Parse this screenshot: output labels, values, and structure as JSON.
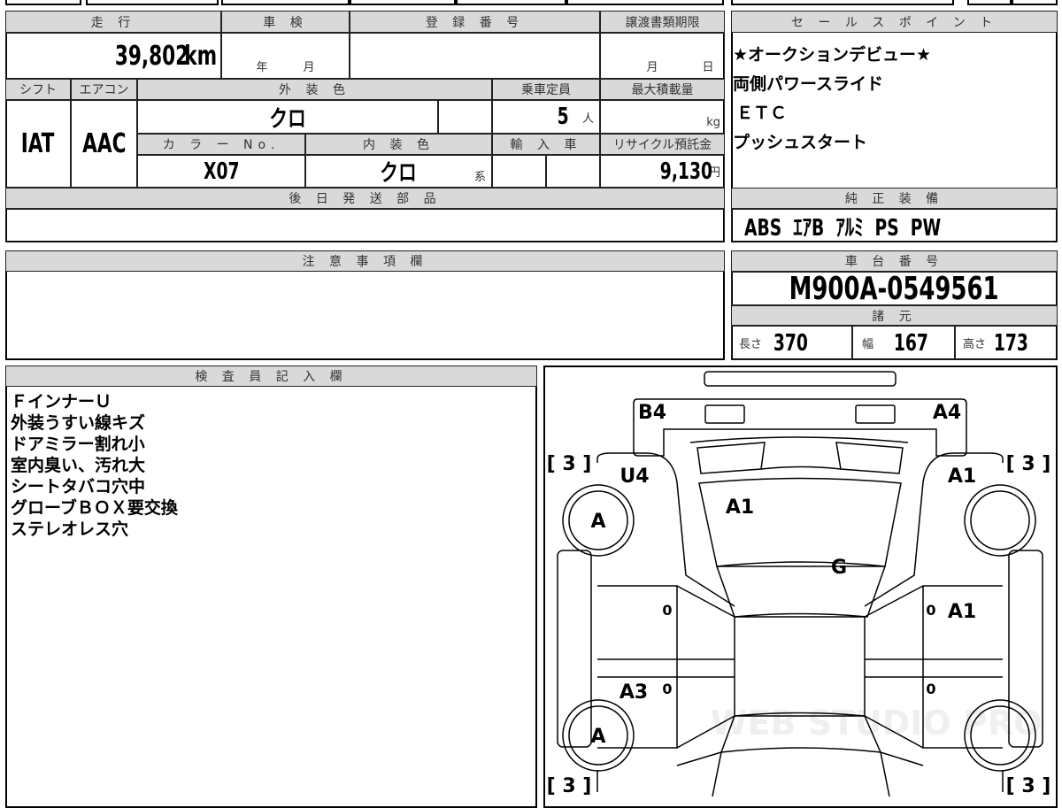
{
  "main_table": {
    "mileage_header": "走 行",
    "mileage": "39,802",
    "mileage_unit": "km",
    "inspection_header": "車 検",
    "year_label": "年",
    "month_label": "月",
    "registration_header": "登 録 番 号",
    "transfer_deadline_header": "譲渡書類期限",
    "deadline_month": "月",
    "deadline_day": "日",
    "shift_header": "シフト",
    "shift": "IAT",
    "ac_header": "エアコン",
    "ac": "AAC",
    "exterior_color_header": "外 装 色",
    "exterior_color": "クロ",
    "capacity_header": "乗車定員",
    "capacity": "5",
    "capacity_unit": "人",
    "max_load_header": "最大積載量",
    "max_load_unit": "kg",
    "color_no_header": "カ ラ ー No.",
    "color_no": "X07",
    "interior_color_header": "内 装 色",
    "interior_color": "クロ",
    "interior_suffix": "系",
    "import_header": "輸 入 車",
    "recycle_header": "リサイクル預託金",
    "recycle_fee": "9,130",
    "recycle_unit": "円",
    "parts_header": "後 日 発 送 部 品"
  },
  "sales_points": {
    "header": "セ ー ル ス ポ イ ン ト",
    "items": [
      "★オークションデビュー★",
      "両側パワースライド",
      "ＥＴＣ",
      "プッシュスタート"
    ]
  },
  "equipment": {
    "header": "純 正 装 備",
    "value": "ABS  ｴｱB  ｱﾙﾐ  PS  PW"
  },
  "notes": {
    "header": "注 意 事 項 欄"
  },
  "chassis": {
    "header": "車 台 番 号",
    "number": "M900A-0549561"
  },
  "specs": {
    "header": "諸 元",
    "length_label": "長さ",
    "length": "370",
    "width_label": "幅",
    "width": "167",
    "height_label": "高さ",
    "height": "173"
  },
  "inspector": {
    "header": "検 査 員 記 入 欄",
    "lines": [
      "ＦインナーＵ",
      "外装うすい線キズ",
      "ドアミラー割れ小",
      "室内臭い、汚れ大",
      "シートタバコ穴中",
      "グローブＢＯＸ要交換",
      "ステレオレス穴"
    ]
  },
  "diagram": {
    "labels": {
      "rear_left": "B4",
      "rear_right": "A4",
      "rear_quarter_left": "U4",
      "rear_quarter_right": "A1",
      "rear_glass": "A1",
      "roof": "G",
      "rear_door_right": "A1",
      "front_door_left": "A3",
      "wheel_rl": "A",
      "wheel_fl": "A",
      "door_mark": "0",
      "tire_tread": "[ 3 ]"
    },
    "watermark": "WEB STUDIO PRO"
  }
}
